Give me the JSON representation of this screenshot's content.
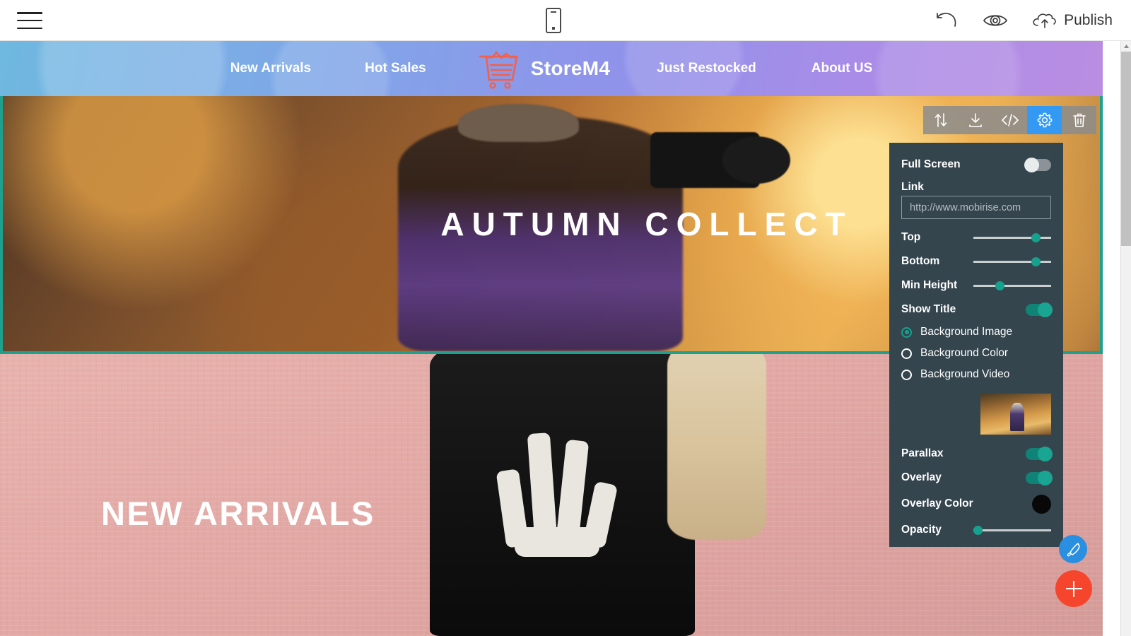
{
  "topbar": {
    "menu_icon": "hamburger-menu-icon",
    "device_icon": "mobile-preview-icon",
    "undo_icon": "undo-icon",
    "preview_icon": "eye-preview-icon",
    "publish_icon": "cloud-upload-icon",
    "publish_label": "Publish"
  },
  "block_toolbar": {
    "move_icon": "move-updown-icon",
    "download_icon": "download-icon",
    "code_icon": "code-brackets-icon",
    "settings_icon": "gear-icon",
    "delete_icon": "trash-icon",
    "active": "gear-icon",
    "active_color": "#3399f3"
  },
  "sitenav": {
    "brand": "StoreM4",
    "brand_icon": "shopping-cart-icon",
    "brand_icon_color": "#f4604a",
    "left_links": [
      "New Arrivals",
      "Hot Sales"
    ],
    "right_links": [
      "Just Restocked",
      "About US"
    ]
  },
  "hero1": {
    "title": "AUTUMN COLLECT",
    "selected": true,
    "selection_color": "#1fa08f"
  },
  "hero2": {
    "title": "NEW ARRIVALS"
  },
  "panel": {
    "full_screen": {
      "label": "Full Screen",
      "value": "off"
    },
    "link": {
      "label": "Link",
      "placeholder": "http://www.mobirise.com",
      "value": ""
    },
    "top": {
      "label": "Top",
      "value": 82
    },
    "bottom": {
      "label": "Bottom",
      "value": 82
    },
    "min_height": {
      "label": "Min Height",
      "value": 30
    },
    "show_title": {
      "label": "Show Title",
      "value": "on"
    },
    "background_options": [
      {
        "label": "Background Image",
        "selected": true
      },
      {
        "label": "Background Color",
        "selected": false
      },
      {
        "label": "Background Video",
        "selected": false
      }
    ],
    "thumbnail": "autumn-forest-thumbnail",
    "parallax": {
      "label": "Parallax",
      "value": "on"
    },
    "overlay": {
      "label": "Overlay",
      "value": "on"
    },
    "overlay_color": {
      "label": "Overlay Color",
      "value": "#080808"
    },
    "opacity": {
      "label": "Opacity",
      "value": 3
    },
    "accent_color": "#16a18e",
    "background_color": "#35454e"
  },
  "fabs": {
    "pen_icon": "pen-brush-icon",
    "pen_color": "#2a8fe0",
    "add_icon": "plus-icon",
    "add_color": "#f5462d"
  },
  "scrollbar": {
    "up_icon": "scroll-up-arrow-icon"
  }
}
